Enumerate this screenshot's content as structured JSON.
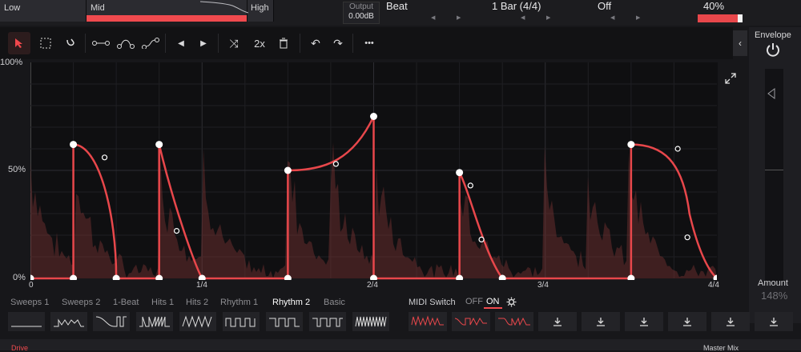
{
  "bands": {
    "low": "Low",
    "mid": "Mid",
    "high": "High"
  },
  "output": {
    "label": "Output",
    "value": "0.00dB"
  },
  "params": {
    "mode": "Beat",
    "length": "1 Bar (4/4)",
    "sync": "Off",
    "amount": "40%",
    "amount_fraction": 0.4
  },
  "toolbar": {
    "double_label": "2x",
    "more_label": "•••"
  },
  "graph": {
    "y_ticks": [
      "100%",
      "50%",
      "0%"
    ],
    "x_ticks": [
      "0",
      "1/4",
      "2/4",
      "3/4",
      "4/4"
    ]
  },
  "envelope": {
    "title": "Envelope",
    "amount_label": "Amount",
    "amount_value": "148%"
  },
  "presets": {
    "tabs": [
      "Sweeps 1",
      "Sweeps 2",
      "1-Beat",
      "Hits 1",
      "Hits 2",
      "Rhythm 1",
      "Rhythm 2",
      "Basic"
    ],
    "active_tab": "Rhythm 2"
  },
  "midi": {
    "label": "MIDI Switch",
    "off": "OFF",
    "on": "ON"
  },
  "bottom": {
    "left": "Drive",
    "right": "Master Mix"
  },
  "colors": {
    "accent": "#f04a4e",
    "curve": "#e8474b",
    "bg": "#17171a"
  }
}
